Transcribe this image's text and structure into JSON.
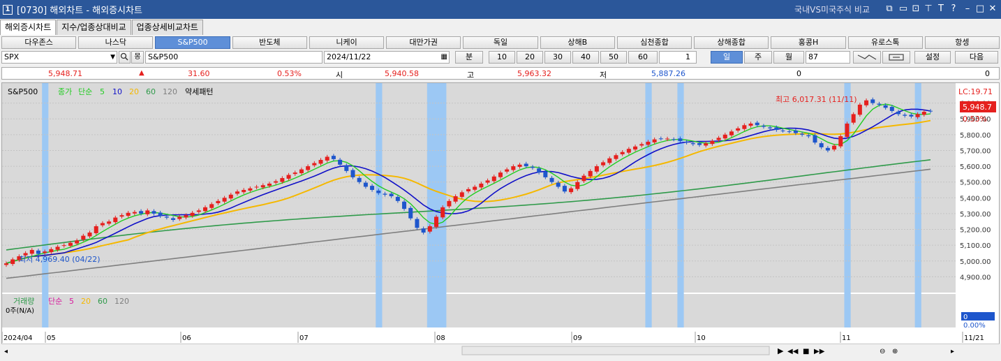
{
  "window": {
    "number": "1",
    "title": "[0730] 해외차트 - 해외증시차트",
    "right_label": "국내VS미국주식 비교",
    "controls": [
      "⧉",
      "▭",
      "⊡",
      "⊤",
      "T",
      "?",
      "–",
      "□",
      "✕"
    ]
  },
  "tabs": [
    {
      "label": "해외증시차트",
      "active": true
    },
    {
      "label": "지수/업종상대비교",
      "active": false
    },
    {
      "label": "업종상세비교차트",
      "active": false
    }
  ],
  "indices": [
    {
      "label": "다우존스",
      "active": false
    },
    {
      "label": "나스닥",
      "active": false
    },
    {
      "label": "S&P500",
      "active": true
    },
    {
      "label": "반도체",
      "active": false
    },
    {
      "label": "니케이",
      "active": false
    },
    {
      "label": "대만가권",
      "active": false
    },
    {
      "label": "독일",
      "active": false
    },
    {
      "label": "상해B",
      "active": false
    },
    {
      "label": "심천종합",
      "active": false
    },
    {
      "label": "상해종합",
      "active": false
    },
    {
      "label": "홍콩H",
      "active": false
    },
    {
      "label": "유로스톡",
      "active": false
    },
    {
      "label": "항셍",
      "active": false
    }
  ],
  "controls": {
    "symbol": "SPX",
    "symbol_name": "S&P500",
    "date": "2024/11/22",
    "minute_label": "분",
    "minutes": [
      "10",
      "20",
      "30",
      "40",
      "50",
      "60"
    ],
    "count_value": "1",
    "period_day": "일",
    "period_week": "주",
    "period_month": "월",
    "bars": "87",
    "settings": "설정",
    "next": "다음"
  },
  "quote": {
    "price": "5,948.71",
    "change": "31.60",
    "change_pct": "0.53%",
    "open_label": "시",
    "open": "5,940.58",
    "high_label": "고",
    "high": "5,963.32",
    "low_label": "저",
    "low": "5,887.26",
    "volume": "0",
    "right_value": "0"
  },
  "chart_data": {
    "type": "candlestick",
    "title": "S&P500",
    "legend": {
      "price_label": "종가",
      "ma_label": "단순",
      "periods": [
        "5",
        "10",
        "20",
        "60",
        "120"
      ],
      "pattern_label": "약세패턴"
    },
    "colors": {
      "up": "#e5201e",
      "down": "#1e56cc",
      "ma5": "#22cc22",
      "ma10": "#1010c8",
      "ma20": "#f5b800",
      "ma60": "#2f9a4a",
      "ma120": "#7f7f7f",
      "highlight": "#9cc8f4"
    },
    "high_note": "최고 6,017.31 (11/11)",
    "low_note": "최저 4,969.40 (04/22)",
    "lc_label": "LC:19.71",
    "last_price": "5,948.7",
    "last_pct": "0.53%",
    "ylim": [
      4800,
      6100
    ],
    "y_ticks": [
      "6,000.00",
      "5,900.00",
      "5,800.00",
      "5,700.00",
      "5,600.00",
      "5,500.00",
      "5,400.00",
      "5,300.00",
      "5,200.00",
      "5,100.00",
      "5,000.00",
      "4,900.00"
    ],
    "x_labels": [
      "2024/04",
      "05",
      "06",
      "07",
      "08",
      "09",
      "10",
      "11",
      "11/21"
    ],
    "volume_panel": {
      "title": "거래량",
      "ma_label": "단순",
      "periods": [
        "5",
        "20",
        "60",
        "120"
      ],
      "unit": "0주(N/A)",
      "last_value": "0",
      "last_pct": "0.00%"
    },
    "closes": [
      4985,
      5010,
      5030,
      5050,
      5070,
      5045,
      5060,
      5075,
      5090,
      5100,
      5115,
      5130,
      5160,
      5180,
      5220,
      5240,
      5250,
      5275,
      5290,
      5305,
      5310,
      5300,
      5320,
      5300,
      5285,
      5275,
      5260,
      5280,
      5290,
      5305,
      5320,
      5340,
      5360,
      5380,
      5400,
      5420,
      5440,
      5450,
      5460,
      5470,
      5480,
      5490,
      5505,
      5525,
      5545,
      5560,
      5580,
      5600,
      5620,
      5640,
      5660,
      5645,
      5610,
      5570,
      5530,
      5500,
      5470,
      5450,
      5430,
      5420,
      5410,
      5380,
      5330,
      5270,
      5210,
      5180,
      5220,
      5280,
      5340,
      5380,
      5410,
      5435,
      5455,
      5470,
      5490,
      5510,
      5535,
      5560,
      5580,
      5600,
      5610,
      5600,
      5590,
      5560,
      5530,
      5500,
      5470,
      5440,
      5460,
      5500,
      5540,
      5570,
      5600,
      5625,
      5650,
      5670,
      5690,
      5710,
      5725,
      5740,
      5755,
      5770,
      5775,
      5775,
      5770,
      5760,
      5750,
      5740,
      5735,
      5745,
      5760,
      5780,
      5800,
      5820,
      5840,
      5860,
      5870,
      5860,
      5850,
      5840,
      5830,
      5825,
      5820,
      5810,
      5800,
      5790,
      5750,
      5720,
      5700,
      5730,
      5790,
      5870,
      5930,
      5990,
      6017,
      6000,
      5990,
      5970,
      5950,
      5930,
      5920,
      5915,
      5930,
      5945,
      5948
    ]
  }
}
